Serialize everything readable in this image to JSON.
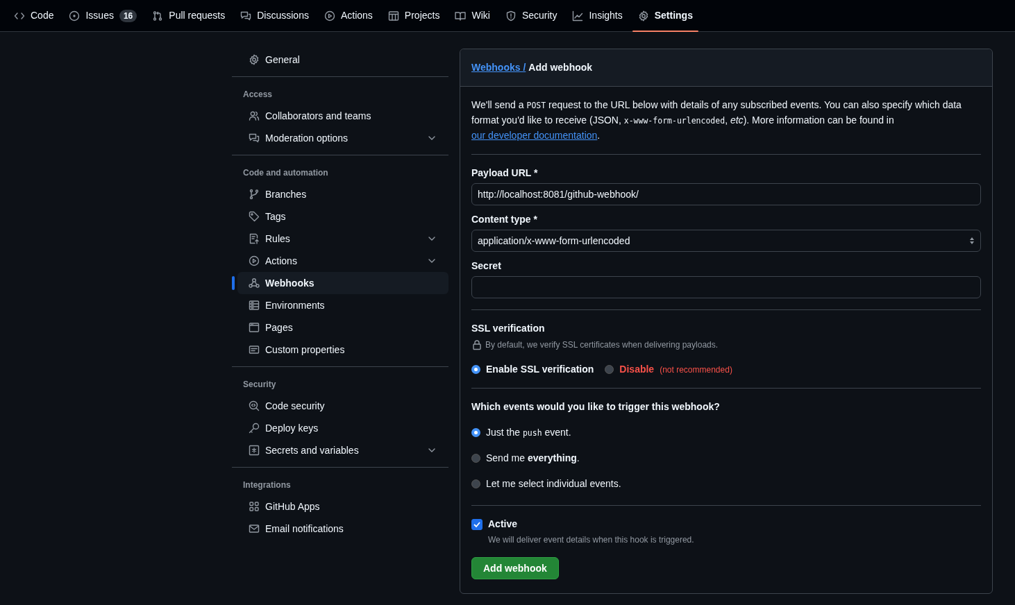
{
  "repo_nav": [
    {
      "label": "Code",
      "selected": false
    },
    {
      "label": "Issues",
      "count": "16",
      "selected": false
    },
    {
      "label": "Pull requests",
      "selected": false
    },
    {
      "label": "Discussions",
      "selected": false
    },
    {
      "label": "Actions",
      "selected": false
    },
    {
      "label": "Projects",
      "selected": false
    },
    {
      "label": "Wiki",
      "selected": false
    },
    {
      "label": "Security",
      "selected": false
    },
    {
      "label": "Insights",
      "selected": false
    },
    {
      "label": "Settings",
      "selected": true
    }
  ],
  "sidebar": {
    "groups": [
      {
        "items": [
          {
            "label": "General",
            "expandable": false,
            "selected": false
          }
        ]
      },
      {
        "heading": "Access",
        "items": [
          {
            "label": "Collaborators and teams",
            "expandable": false,
            "selected": false
          },
          {
            "label": "Moderation options",
            "expandable": true,
            "selected": false
          }
        ]
      },
      {
        "heading": "Code and automation",
        "items": [
          {
            "label": "Branches",
            "expandable": false,
            "selected": false
          },
          {
            "label": "Tags",
            "expandable": false,
            "selected": false
          },
          {
            "label": "Rules",
            "expandable": true,
            "selected": false
          },
          {
            "label": "Actions",
            "expandable": true,
            "selected": false
          },
          {
            "label": "Webhooks",
            "expandable": false,
            "selected": true
          },
          {
            "label": "Environments",
            "expandable": false,
            "selected": false
          },
          {
            "label": "Pages",
            "expandable": false,
            "selected": false
          },
          {
            "label": "Custom properties",
            "expandable": false,
            "selected": false
          }
        ]
      },
      {
        "heading": "Security",
        "items": [
          {
            "label": "Code security",
            "expandable": false,
            "selected": false
          },
          {
            "label": "Deploy keys",
            "expandable": false,
            "selected": false
          },
          {
            "label": "Secrets and variables",
            "expandable": true,
            "selected": false
          }
        ]
      },
      {
        "heading": "Integrations",
        "items": [
          {
            "label": "GitHub Apps",
            "expandable": false,
            "selected": false
          },
          {
            "label": "Email notifications",
            "expandable": false,
            "selected": false
          }
        ]
      }
    ]
  },
  "breadcrumb": {
    "parent": "Webhooks /",
    "current": "Add webhook"
  },
  "intro": [
    {
      "kind": "text",
      "text": "We'll send a "
    },
    {
      "kind": "code",
      "text": "POST"
    },
    {
      "kind": "text",
      "text": " request to the URL below with details of any subscribed events. You can also specify which data format you'd like to receive (JSON, "
    },
    {
      "kind": "code",
      "text": "x-www-form-urlencoded"
    },
    {
      "kind": "text",
      "text": ", *etc*). More information can be found in "
    },
    {
      "kind": "link",
      "text": "our developer documentation"
    },
    {
      "kind": "text",
      "text": "."
    }
  ],
  "fields": [
    {
      "kind": "input",
      "label": "Payload URL *",
      "value": "http://localhost:8081/github-webhook/"
    },
    {
      "kind": "select",
      "label": "Content type *",
      "value": "application/x-www-form-urlencoded"
    },
    {
      "kind": "input",
      "label": "Secret"
    }
  ],
  "ssl": {
    "title": "SSL verification",
    "note": "By default, we verify SSL certificates when delivering payloads.",
    "options": [
      {
        "label": "Enable SSL verification",
        "danger": false,
        "selected": true
      },
      {
        "label": "Disable",
        "note": "(not recommended)",
        "danger": true,
        "selected": false
      }
    ]
  },
  "events": {
    "question": "Which events would you like to trigger this webhook?",
    "options": [
      {
        "parts": [
          {
            "kind": "text",
            "text": "Just the "
          },
          {
            "kind": "code",
            "text": "push"
          },
          {
            "kind": "text",
            "text": " event."
          }
        ],
        "selected": true
      },
      {
        "parts": [
          {
            "kind": "text",
            "text": "Send me **everything**."
          }
        ],
        "selected": false
      },
      {
        "parts": [
          {
            "kind": "text",
            "text": "Let me select individual events."
          }
        ],
        "selected": false
      }
    ]
  },
  "active": {
    "label": "Active",
    "checked": true,
    "hint": "We will deliver event details when this hook is triggered."
  },
  "submit": "Add webhook"
}
